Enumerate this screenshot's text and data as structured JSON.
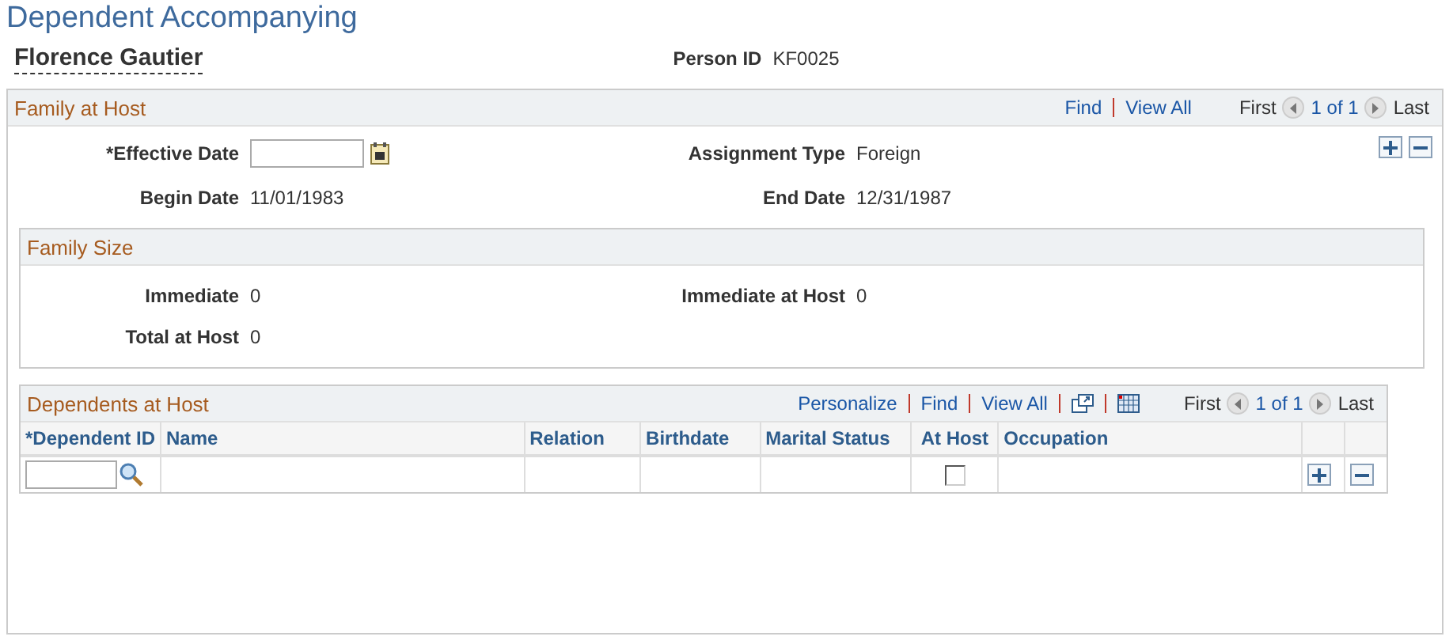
{
  "page_title": "Dependent Accompanying",
  "person": {
    "name": "Florence Gautier",
    "id_label": "Person ID",
    "id": "KF0025"
  },
  "family_at_host": {
    "title": "Family at Host",
    "nav": {
      "find": "Find",
      "view_all": "View All",
      "first": "First",
      "counter": "1 of 1",
      "last": "Last"
    },
    "fields": [
      {
        "kind": "date_input",
        "label": "*Effective Date"
      },
      {
        "kind": "text",
        "label": "Assignment Type",
        "value": "Foreign"
      },
      {
        "kind": "text",
        "label": "Begin Date",
        "value": "11/01/1983"
      },
      {
        "kind": "text",
        "label": "End Date",
        "value": "12/31/1987"
      }
    ],
    "family_size": {
      "title": "Family Size",
      "fields": [
        {
          "kind": "text",
          "label": "Immediate",
          "value": "0"
        },
        {
          "kind": "text",
          "label": "Immediate at Host",
          "value": "0"
        },
        {
          "kind": "text",
          "label": "Total at Host",
          "value": "0"
        }
      ]
    },
    "dependents": {
      "title": "Dependents at Host",
      "nav": {
        "personalize": "Personalize",
        "find": "Find",
        "view_all": "View All",
        "first": "First",
        "counter": "1 of 1",
        "last": "Last"
      },
      "columns": [
        "*Dependent ID",
        "Name",
        "Relation",
        "Birthdate",
        "Marital Status",
        "At Host",
        "Occupation"
      ],
      "rows": [
        {
          "at_host": false
        }
      ]
    }
  }
}
